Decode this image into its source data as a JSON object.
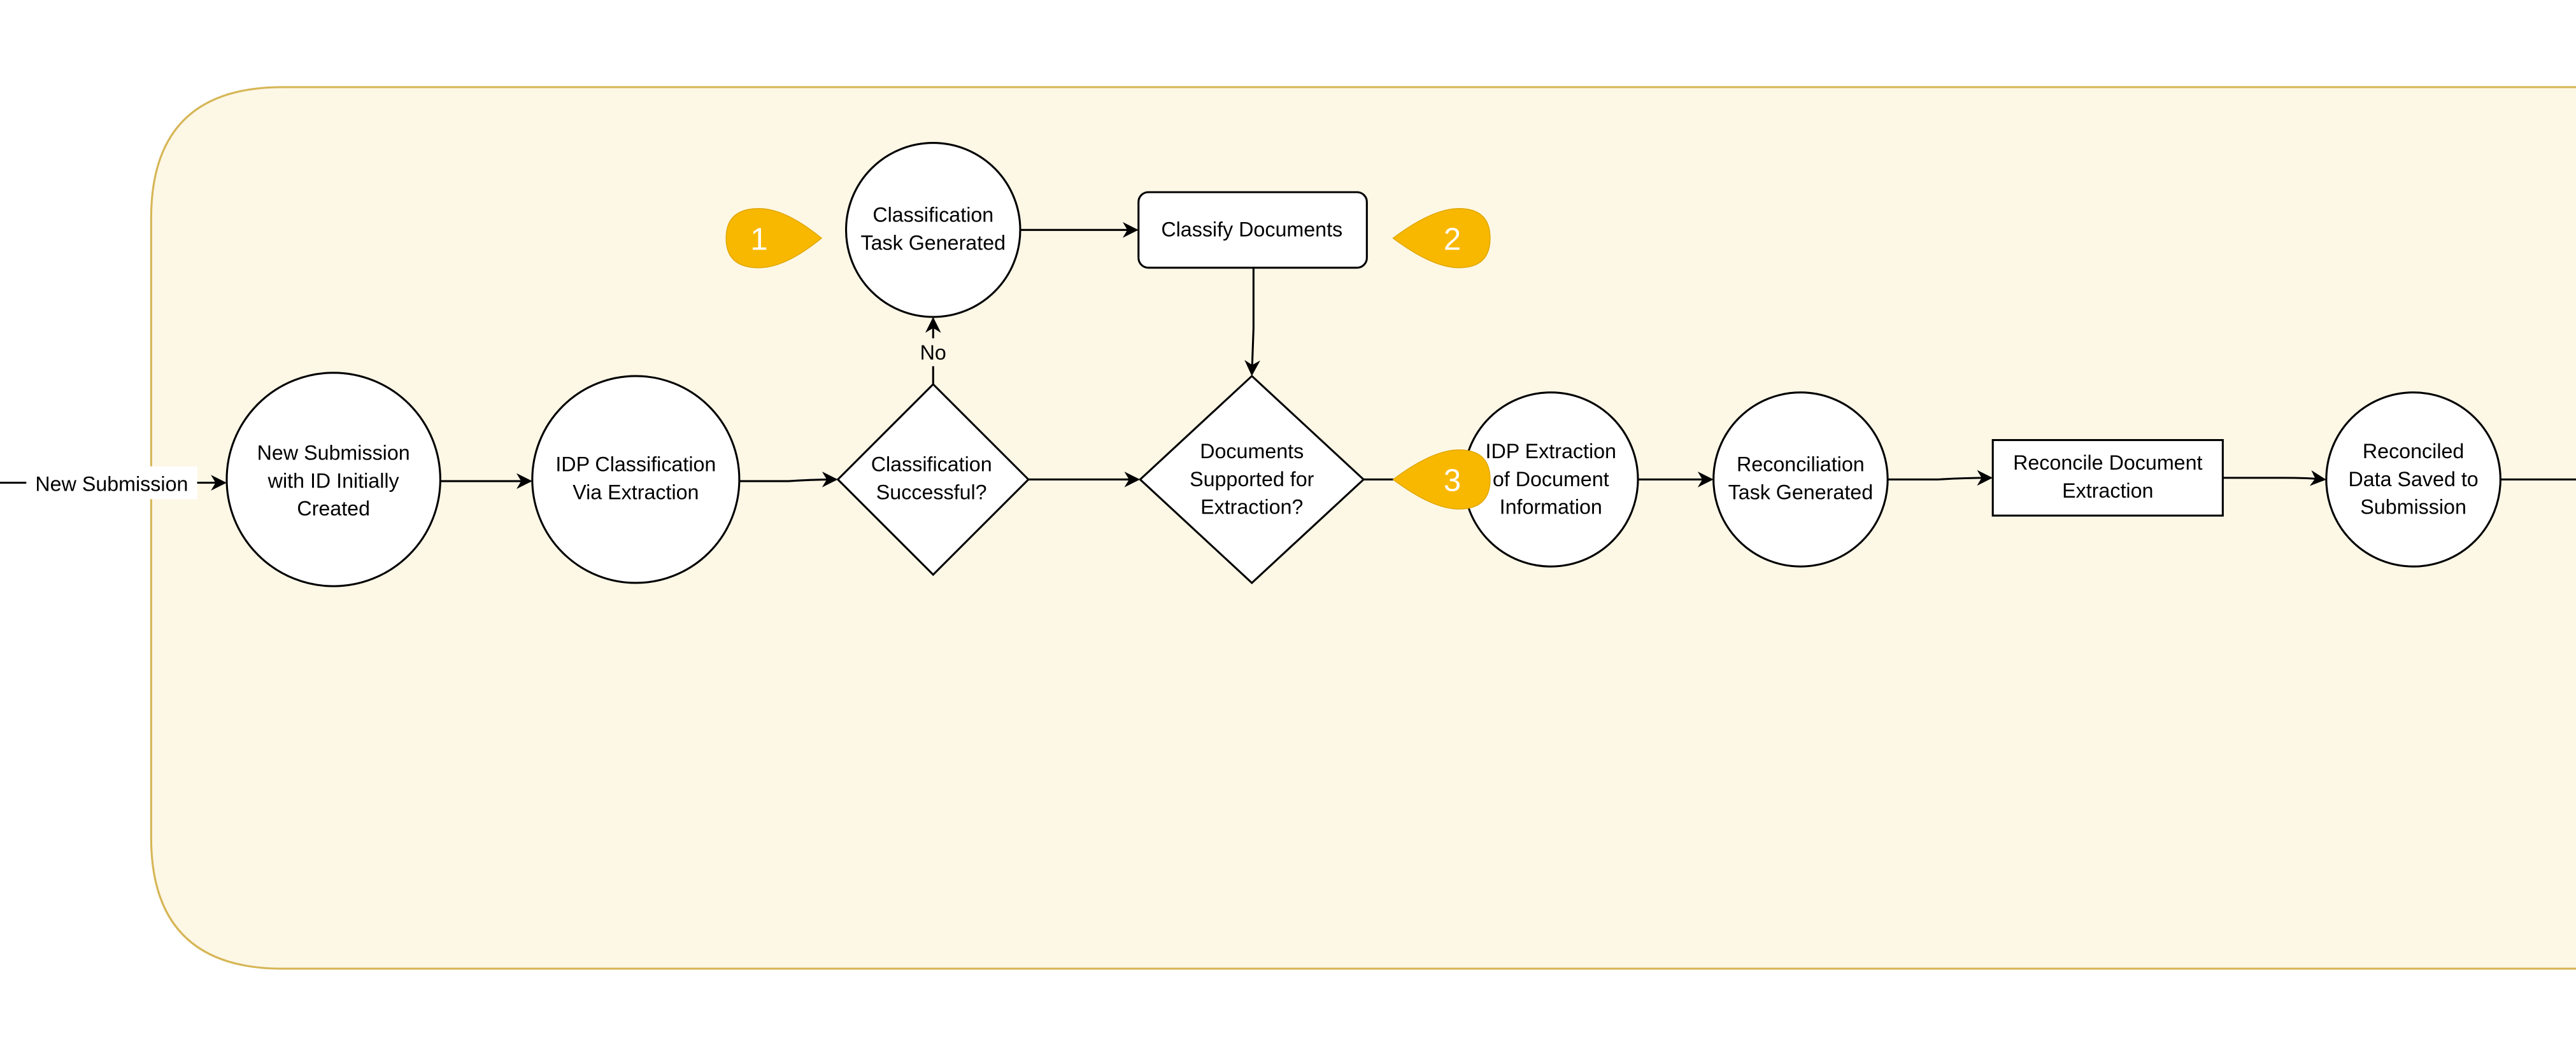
{
  "colors": {
    "lane_fill": "#fdf7e6",
    "lane_stroke": "#d6b656",
    "marker": "#f9b800",
    "node_fill": "#ffffff",
    "stroke": "#000000"
  },
  "edges": {
    "entry_label": "New Submission",
    "no_label": "No"
  },
  "nodes": {
    "new_submission": [
      "New Submission",
      "with ID Initially",
      "Created"
    ],
    "idp_classification": [
      "IDP Classification",
      "Via Extraction"
    ],
    "classification_successful": [
      "Classification",
      "Successful?"
    ],
    "classification_task": [
      "Classification",
      "Task Generated"
    ],
    "classify_documents": [
      "Classify Documents"
    ],
    "documents_supported": [
      "Documents",
      "Supported for",
      "Extraction?"
    ],
    "idp_extraction": [
      "IDP Extraction",
      "of Document",
      "Information"
    ],
    "reconciliation_task": [
      "Reconciliation",
      "Task Generated"
    ],
    "reconcile_extraction": [
      "Reconcile Document",
      "Extraction"
    ],
    "reconciled_saved": [
      "Reconciled",
      "Data Saved to",
      "Submission"
    ]
  },
  "markers": [
    "1",
    "2",
    "3"
  ]
}
